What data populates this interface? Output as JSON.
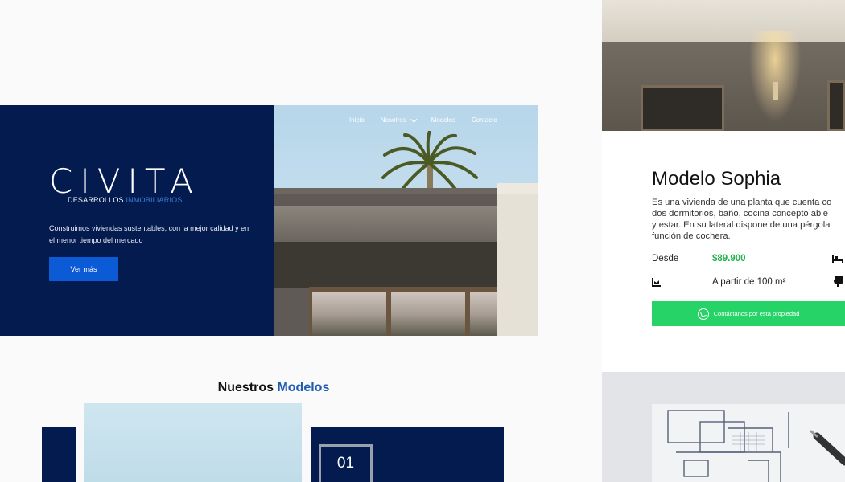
{
  "colors": {
    "navy": "#031b4e",
    "accent_blue": "#1e5cb3",
    "button_blue": "#0b5ad6",
    "whatsapp_green": "#25d366",
    "price_green": "#22b24c"
  },
  "hero": {
    "logo_text": "CIVITA",
    "logo_sub_main": "DESARROLLOS",
    "logo_sub_accent": "INMOBILIARIOS",
    "tagline": "Construimos viviendas sustentables, con la mejor calidad y en el menor tiempo del mercado",
    "cta_label": "Ver más"
  },
  "nav": {
    "items": [
      {
        "label": "Inicio"
      },
      {
        "label": "Nosotros",
        "has_dropdown": true
      },
      {
        "label": "Modelos"
      },
      {
        "label": "Contacto"
      }
    ]
  },
  "models_section": {
    "title_main": "Nuestros",
    "title_accent": "Modelos",
    "card_number": "01"
  },
  "model_detail": {
    "title": "Modelo Sophia",
    "description": "Es una vivienda de una planta que cuenta co\ndos dormitorios, baño, cocina concepto abie\ny estar. En su lateral dispone de una pérgola\nfunción de cochera.",
    "price_label": "Desde",
    "price_value": "$89.900",
    "area_value": "A partir de 100 m²",
    "contact_button": "Contáctanos por esta propiedad"
  },
  "icons": [
    "chevron-down-icon",
    "bed-icon",
    "area-icon",
    "toilet-icon",
    "whatsapp-icon"
  ]
}
